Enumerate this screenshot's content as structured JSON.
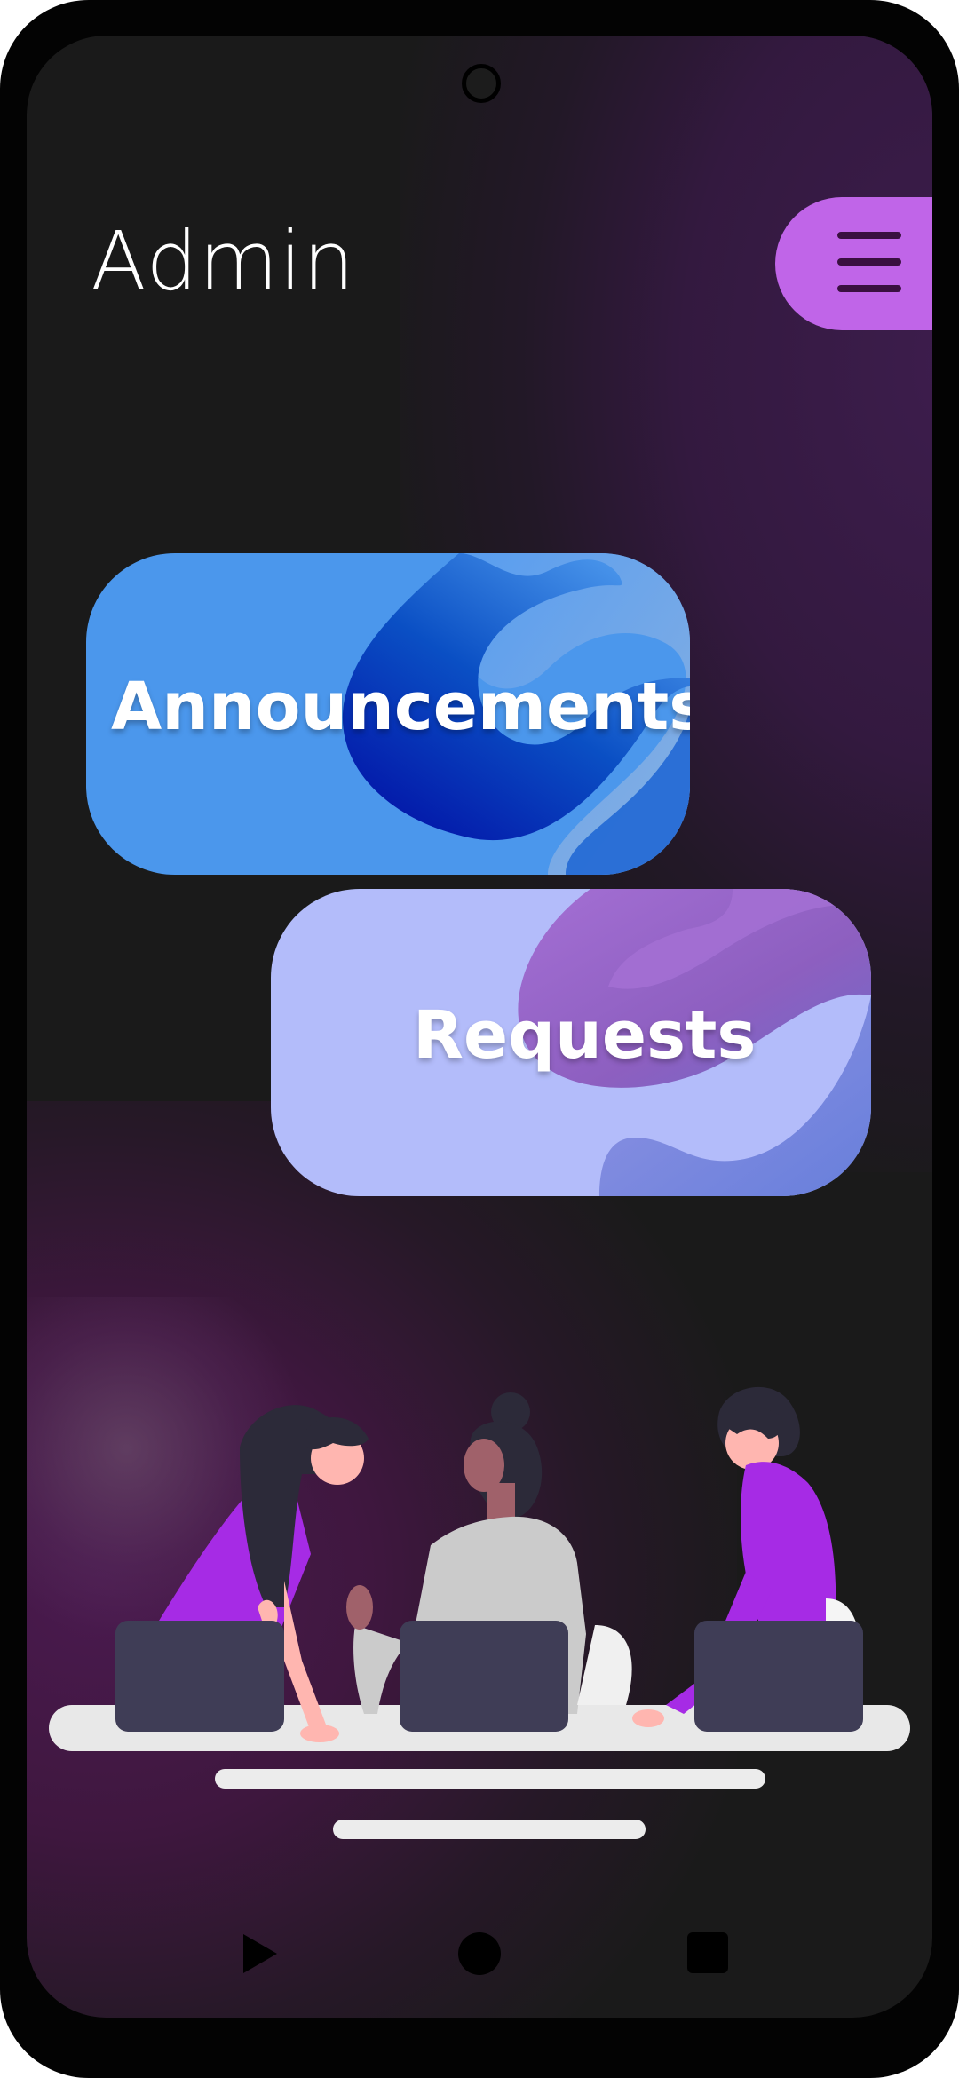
{
  "header": {
    "title": "Admin"
  },
  "menu": {
    "icon": "hamburger-menu-icon",
    "color": "#c065e8"
  },
  "cards": [
    {
      "label": "Announcements",
      "color": "#4b97ec"
    },
    {
      "label": "Requests",
      "color": "#b3bcfa"
    }
  ],
  "illustration": {
    "name": "team-working-at-laptops"
  },
  "navigation": {
    "icons": [
      "back-triangle-icon",
      "home-circle-icon",
      "recents-square-icon"
    ]
  },
  "theme": {
    "background": "#1a1a1a",
    "glow": "#3d1d4d",
    "accent_purple": "#a62be5"
  }
}
